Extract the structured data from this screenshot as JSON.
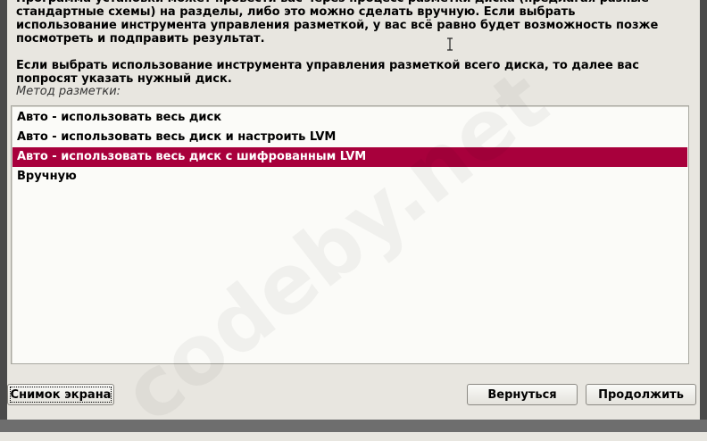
{
  "description": {
    "paragraph1": "Программа установки может провести вас через процесс разметки диска (предлагая разные стандартные схемы) на разделы, либо это можно сделать вручную. Если выбрать использование инструмента управления разметкой, у вас всё равно будет возможность позже посмотреть и подправить результат.",
    "paragraph2": "Если выбрать использование инструмента управления разметкой всего диска, то далее вас попросят указать нужный диск."
  },
  "method_label": "Метод разметки:",
  "options": [
    {
      "label": "Авто - использовать весь диск",
      "selected": false
    },
    {
      "label": "Авто - использовать весь диск и настроить LVM",
      "selected": false
    },
    {
      "label": "Авто - использовать весь диск с шифрованным LVM",
      "selected": true
    },
    {
      "label": "Вручную",
      "selected": false
    }
  ],
  "buttons": {
    "screenshot": "Снимок экрана",
    "back": "Вернуться",
    "continue": "Продолжить"
  },
  "watermark": "codeby.net",
  "colors": {
    "selection": "#a8003c",
    "background": "#e8e6e0",
    "list_background": "#fbfbf8"
  }
}
